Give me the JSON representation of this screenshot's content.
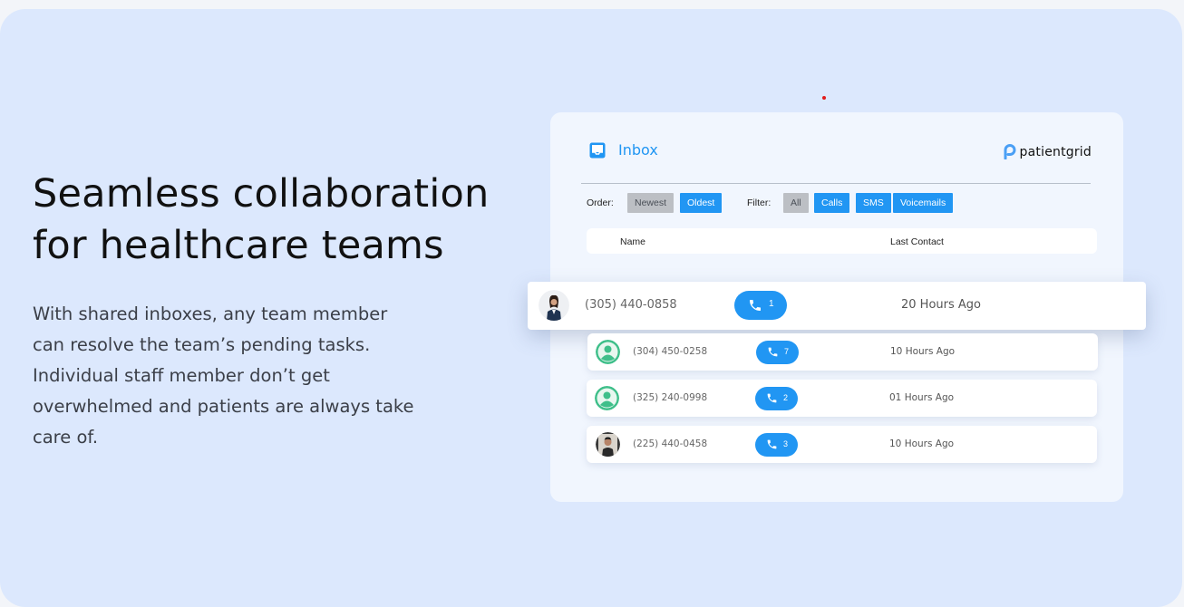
{
  "hero": {
    "headline_line1": "Seamless collaboration",
    "headline_line2": "for healthcare teams",
    "body_line1": "With shared inboxes, any team member",
    "body_line2": "can resolve the team’s pending tasks.",
    "body_line3": "Individual staff member don’t get",
    "body_line4": "overwhelmed and patients are always take",
    "body_line5": "care of."
  },
  "inbox": {
    "title": "Inbox",
    "icon": "inbox-tray-icon",
    "brand": "patientgrid",
    "brand_icon": "patientgrid-logo-icon",
    "order_label": "Order:",
    "order_options": [
      "Newest",
      "Oldest"
    ],
    "order_selected": "Oldest",
    "filter_label": "Filter:",
    "filter_options": [
      "All",
      "Calls",
      "SMS",
      "Voicemails"
    ],
    "columns": {
      "name": "Name",
      "last_contact": "Last Contact"
    },
    "rows": [
      {
        "phone": "(305) 440-0858",
        "count": "1",
        "last_contact": "20 Hours Ago",
        "avatar": "photo-woman-suit"
      },
      {
        "phone": "(304) 450-0258",
        "count": "7",
        "last_contact": "10 Hours Ago",
        "avatar": "default-user-icon"
      },
      {
        "phone": "(325) 240-0998",
        "count": "2",
        "last_contact": "01 Hours Ago",
        "avatar": "default-user-icon"
      },
      {
        "phone": "(225) 440-0458",
        "count": "3",
        "last_contact": "10 Hours Ago",
        "avatar": "photo-man"
      }
    ]
  },
  "colors": {
    "accent": "#2196f3",
    "card_bg": "#dce8fd",
    "panel_bg": "#f1f6fe",
    "user_green": "#3fbf8a",
    "chip_gray": "#bcbfc4"
  }
}
